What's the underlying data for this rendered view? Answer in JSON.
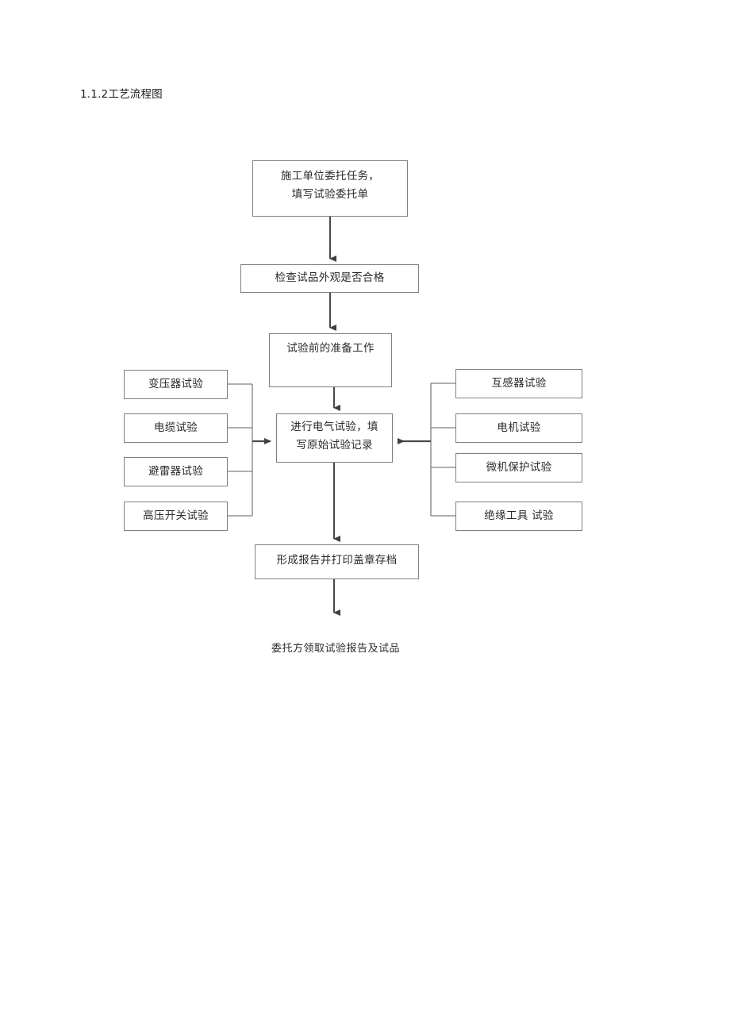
{
  "document": {
    "heading": "1.1.2工艺流程图"
  },
  "diagram": {
    "type": "flowchart",
    "title": "工艺流程图",
    "line_color": "#808080",
    "arrow_color": "#404040",
    "text_color": "#2b2b2b",
    "background": "#ffffff",
    "main_flow": [
      {
        "id": "start",
        "label": "施工单位委托任务，\n填写试验委托单"
      },
      {
        "id": "check",
        "label": "检查试品外观是否合格"
      },
      {
        "id": "prep",
        "label": "试验前的准备工作"
      },
      {
        "id": "test",
        "label": "进行电气试验，填\n写原始试验记录"
      },
      {
        "id": "report",
        "label": "形成报告并打印盖章存档"
      },
      {
        "id": "end",
        "label": "委托方领取试验报告及试品",
        "boxed": false
      }
    ],
    "left_branches": [
      {
        "id": "transformer",
        "label": "变压器试验"
      },
      {
        "id": "cable",
        "label": "电缆试验"
      },
      {
        "id": "arrester",
        "label": "避雷器试验"
      },
      {
        "id": "hv-switch",
        "label": "高压开关试验"
      }
    ],
    "right_branches": [
      {
        "id": "instrument-transformer",
        "label": "互感器试验"
      },
      {
        "id": "motor",
        "label": "电机试验"
      },
      {
        "id": "relay-protection",
        "label": "微机保护试验"
      },
      {
        "id": "insulating-tools",
        "label": "绝缘工具 试验"
      }
    ]
  }
}
